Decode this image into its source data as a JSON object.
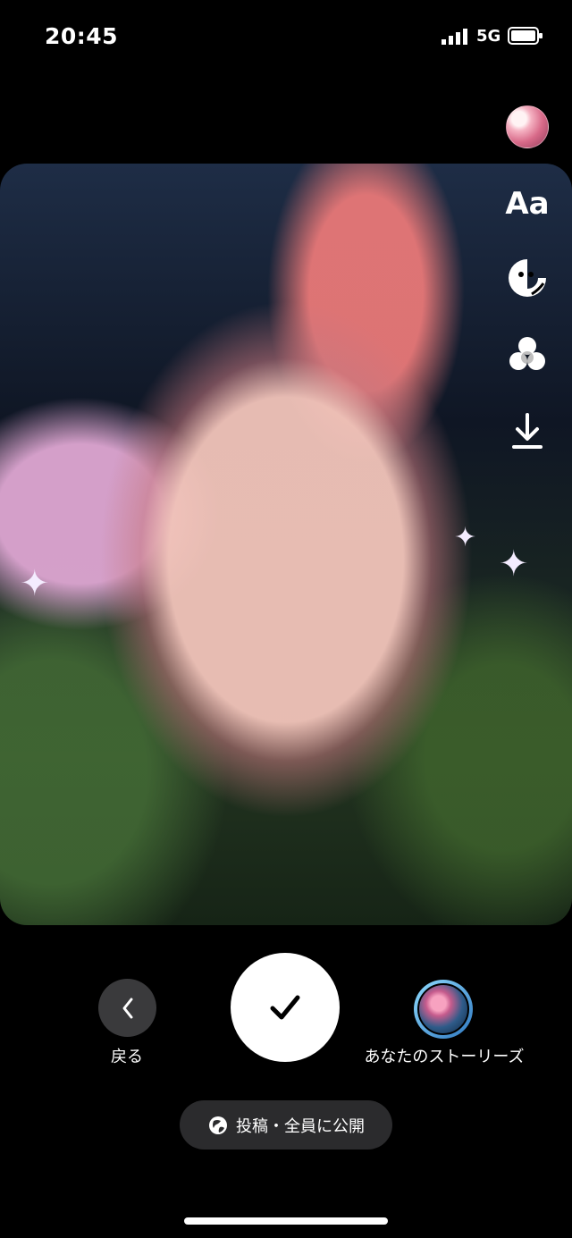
{
  "status": {
    "time": "20:45",
    "network": "5G",
    "icons": [
      "signal-icon",
      "battery-icon"
    ]
  },
  "editor": {
    "text_tool": "Aa",
    "tools": [
      "text-tool",
      "sticker-icon",
      "effects-icon",
      "download-icon"
    ]
  },
  "actions": {
    "back": "戻る",
    "your_story": "あなたのストーリーズ",
    "confirm_icon": "checkmark-icon",
    "back_icon": "chevron-left-icon"
  },
  "privacy": {
    "label": "投稿・全員に公開",
    "icon": "globe-icon"
  },
  "colors": {
    "background": "#000000",
    "button_bg": "#3a3a3c",
    "pill_bg": "#2b2b2d",
    "confirm_bg": "#ffffff",
    "story_ring": "#8fdcff"
  }
}
